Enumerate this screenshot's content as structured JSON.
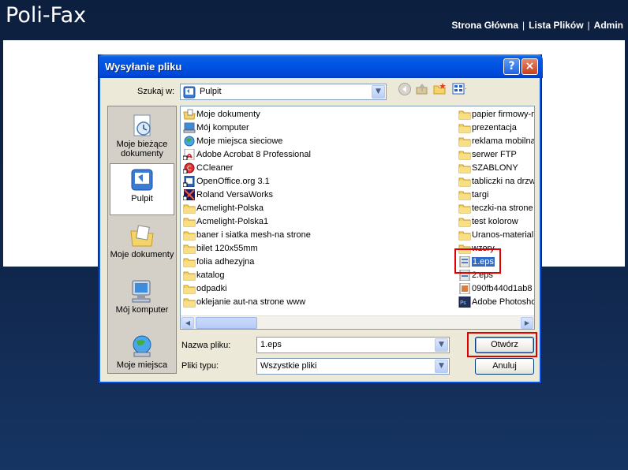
{
  "site": {
    "title": "Poli-Fax",
    "nav": [
      "Strona Główna",
      "Lista Plików",
      "Admin"
    ],
    "nav_separator": "|"
  },
  "dialog": {
    "title": "Wysyłanie pliku",
    "help_label": "?",
    "close_label": "×",
    "look_in_label": "Szukaj w:",
    "look_in_value": "Pulpit",
    "places": [
      {
        "label_line1": "Moje bieżące",
        "label_line2": "dokumenty",
        "icon": "recent-documents-icon"
      },
      {
        "label_line1": "Pulpit",
        "label_line2": "",
        "icon": "desktop-icon"
      },
      {
        "label_line1": "Moje dokumenty",
        "label_line2": "",
        "icon": "my-documents-icon"
      },
      {
        "label_line1": "Mój komputer",
        "label_line2": "",
        "icon": "my-computer-icon"
      },
      {
        "label_line1": "Moje miejsca",
        "label_line2": "",
        "icon": "network-places-icon"
      }
    ],
    "files_left": [
      {
        "name": "Moje dokumenty",
        "icon": "my-documents-icon"
      },
      {
        "name": "Mój komputer",
        "icon": "my-computer-icon"
      },
      {
        "name": "Moje miejsca sieciowe",
        "icon": "network-places-icon"
      },
      {
        "name": "Adobe Acrobat 8 Professional",
        "icon": "acrobat-shortcut-icon"
      },
      {
        "name": "CCleaner",
        "icon": "ccleaner-shortcut-icon"
      },
      {
        "name": "OpenOffice.org 3.1",
        "icon": "openoffice-shortcut-icon"
      },
      {
        "name": "Roland VersaWorks",
        "icon": "versaworks-shortcut-icon"
      },
      {
        "name": "Acmelight-Polska",
        "icon": "folder-icon"
      },
      {
        "name": "Acmelight-Polska1",
        "icon": "folder-icon"
      },
      {
        "name": "baner i siatka mesh-na strone",
        "icon": "folder-icon"
      },
      {
        "name": "bilet 120x55mm",
        "icon": "folder-icon"
      },
      {
        "name": "folia adhezyjna",
        "icon": "folder-icon"
      },
      {
        "name": "katalog",
        "icon": "folder-icon"
      },
      {
        "name": "odpadki",
        "icon": "folder-icon"
      },
      {
        "name": "oklejanie aut-na strone www",
        "icon": "folder-icon"
      }
    ],
    "files_right": [
      {
        "name": "papier firmowy-n",
        "icon": "folder-icon"
      },
      {
        "name": "prezentacja",
        "icon": "folder-icon"
      },
      {
        "name": "reklama mobilna",
        "icon": "folder-icon"
      },
      {
        "name": "serwer FTP",
        "icon": "folder-icon"
      },
      {
        "name": "SZABLONY",
        "icon": "folder-icon"
      },
      {
        "name": "tabliczki na drzw",
        "icon": "folder-icon"
      },
      {
        "name": "targi",
        "icon": "folder-icon"
      },
      {
        "name": "teczki-na strone",
        "icon": "folder-icon"
      },
      {
        "name": "test kolorow",
        "icon": "folder-icon"
      },
      {
        "name": "Uranos-material",
        "icon": "folder-icon"
      },
      {
        "name": "wzory",
        "icon": "folder-icon"
      },
      {
        "name": "1.eps",
        "icon": "eps-file-icon",
        "selected": true
      },
      {
        "name": "2.eps",
        "icon": "eps-file-icon"
      },
      {
        "name": "090fb440d1ab8",
        "icon": "image-file-icon"
      },
      {
        "name": "Adobe Photosho",
        "icon": "photoshop-file-icon"
      }
    ],
    "filename_label": "Nazwa pliku:",
    "filename_value": "1.eps",
    "filetype_label": "Pliki typu:",
    "filetype_value": "Wszystkie pliki",
    "open_button": "Otwórz",
    "cancel_button": "Anuluj"
  },
  "colors": {
    "highlight": "#e00000",
    "selection": "#316ac5",
    "titlebar": "#0055e5"
  }
}
